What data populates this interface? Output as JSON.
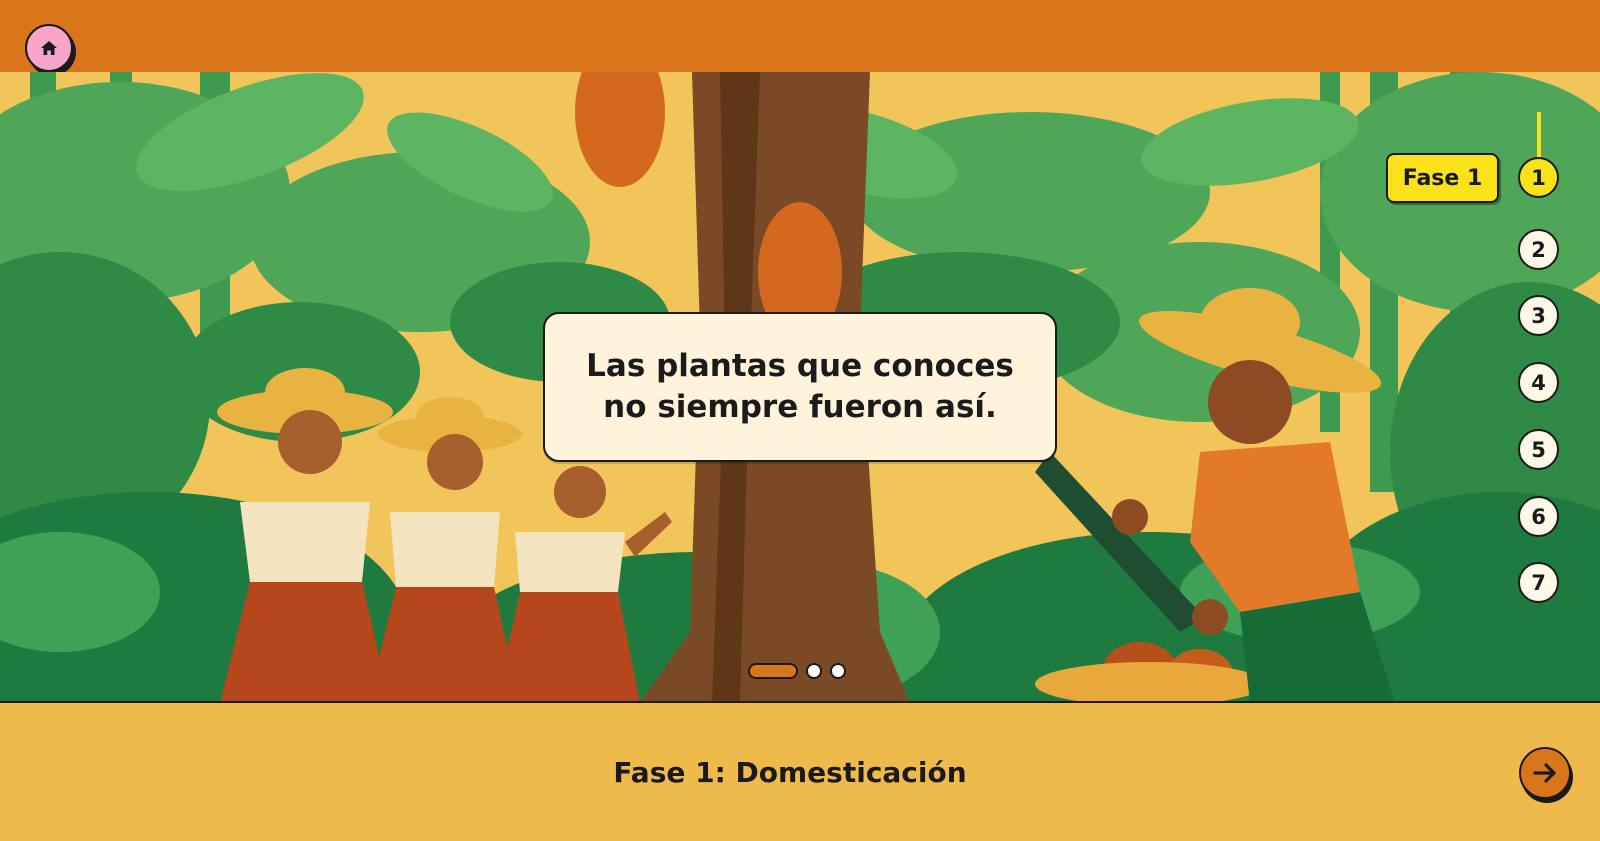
{
  "header": {
    "home_icon": "home-icon"
  },
  "scene": {
    "caption": "Las plantas que conoces\nno siempre fueron así.",
    "dots": [
      {
        "active": true
      },
      {
        "active": false
      },
      {
        "active": false
      }
    ]
  },
  "stepper": {
    "phase_label": "Fase 1",
    "steps": [
      "1",
      "2",
      "3",
      "4",
      "5",
      "6",
      "7"
    ],
    "active_step": "1"
  },
  "footer": {
    "title": "Fase 1: Domesticación",
    "next_icon": "arrow-right-icon"
  },
  "colors": {
    "topbar": "#D9761C",
    "footer": "#EFBA4C",
    "active_badge": "#F9E21A",
    "home_button": "#F7A6C9"
  }
}
